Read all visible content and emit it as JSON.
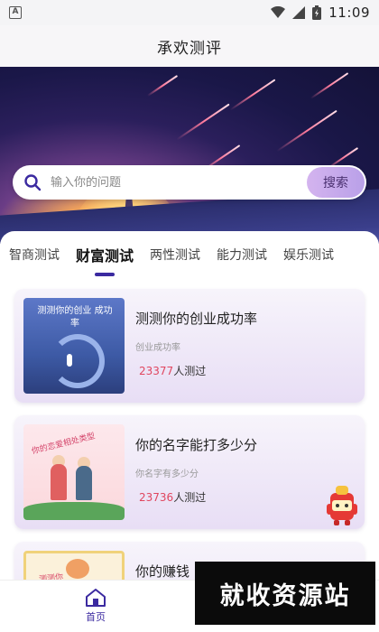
{
  "status_bar": {
    "time": "11:09",
    "left_icon": "android-notification-icon",
    "icons": [
      "wifi-icon",
      "signal-icon",
      "battery-icon"
    ]
  },
  "app": {
    "title": "承欢测评"
  },
  "search": {
    "placeholder": "输入你的问题",
    "button_label": "搜索"
  },
  "tabs": [
    {
      "label": "智商测试",
      "active": false
    },
    {
      "label": "财富测试",
      "active": true
    },
    {
      "label": "两性测试",
      "active": false
    },
    {
      "label": "能力测试",
      "active": false
    },
    {
      "label": "娱乐测试",
      "active": false
    }
  ],
  "cards": [
    {
      "title": "测测你的创业成功率",
      "subtitle": "创业成功率",
      "count": "23377",
      "count_suffix": "人测过",
      "thumb_text": "测测你的创业 成功率"
    },
    {
      "title": "你的名字能打多少分",
      "subtitle": "你名字有多少分",
      "count": "23736",
      "count_suffix": "人测过",
      "thumb_text": "你的恋爱相处类型"
    },
    {
      "title": "你的赚钱",
      "subtitle": "",
      "count": "",
      "count_suffix": "",
      "thumb_text": "测测你"
    }
  ],
  "bottom_nav": {
    "home_label": "首页"
  },
  "watermark": {
    "text": "就收资源站"
  },
  "colors": {
    "accent": "#3b2aa0",
    "count": "#e0465f",
    "search_button": "#c9aef0"
  }
}
